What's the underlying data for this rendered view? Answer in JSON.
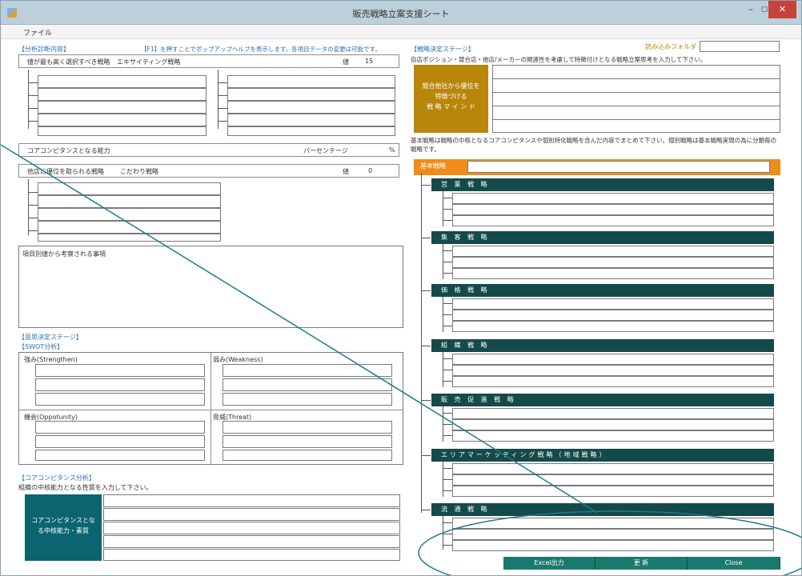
{
  "window": {
    "title": "販売戦略立案支援シート",
    "min": "–",
    "max": "▢",
    "close": "✕"
  },
  "menu": {
    "file": "ファイル"
  },
  "left": {
    "section_label": "【分析診断内容】",
    "help_note": "【F1】を押すことでポップアップヘルプを表示します。各項目データの変更は可能です。",
    "row1": {
      "label": "値が最も高く選択すべき戦略",
      "value": "エキサイティング戦略",
      "value_label": "値",
      "value_num": "15"
    },
    "row2": {
      "label": "コアコンピタンスとなる能力",
      "value_label": "パーセンテージ",
      "unit": "%"
    },
    "row3": {
      "label": "他店に優位を取られる戦略",
      "value": "こだわり戦略",
      "value_label": "値",
      "value_num": "0"
    },
    "consider_label": "項目別値から考察される事項",
    "stage2_label": "【意思決定ステージ】",
    "swot_label": "【SWOT分析】",
    "swot": {
      "strength": "強み(Strengthen)",
      "weakness": "弱み(Weakness)",
      "opportunity": "機会(Oppotunity)",
      "threat": "脅威(Threat)"
    },
    "core_section": "【コアコンピタンス分析】",
    "core_note": "組織の中核能力となる性質を入力して下さい。",
    "core_teal": "コアコンピタンスとなる中核能力・素質"
  },
  "right": {
    "section_label": "【戦略決定ステージ】",
    "folder_label": "読み込みフォルダ",
    "folder_value": "",
    "note1": "自店ポジション・競合店・他店/メーカーの関連性を考慮して特徴付けとなる戦略立案思考を入力して下さい。",
    "gold_text": "競合他社から優位を\n特徴づける\n戦 略 マ イ ン ド",
    "note2": "基本戦略は戦略の中核となるコアコンピタンスや個別特化戦略を含んだ内容でまとめて下さい。個別戦略は基本戦略実現の為に分類毎の戦略です。",
    "basic_label": "基本戦略",
    "strategies": [
      "営 業 戦 略",
      "集 客 戦 略",
      "価 格 戦 略",
      "組 織 戦 略",
      "販 売 促 進 戦 略",
      "エリアマーケッティング戦略（地域戦略）",
      "流 通 戦 略"
    ]
  },
  "buttons": {
    "excel": "Excel出力",
    "update": "更 新",
    "close": "Close"
  }
}
